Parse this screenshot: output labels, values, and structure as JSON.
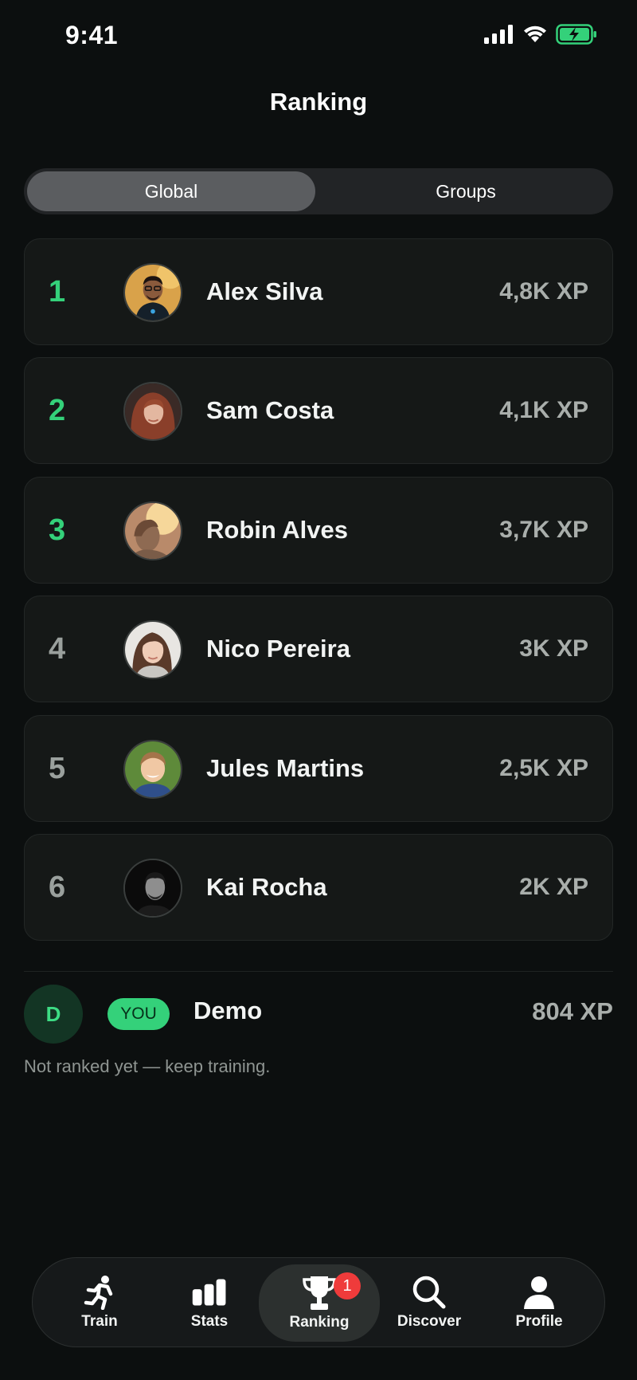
{
  "status_bar": {
    "time": "9:41"
  },
  "header": {
    "title": "Ranking"
  },
  "segments": {
    "global_label": "Global",
    "groups_label": "Groups",
    "selected": "Global"
  },
  "leaderboard": [
    {
      "rank": "1",
      "name": "Alex Silva",
      "xp": "4,8K XP",
      "highlight": true
    },
    {
      "rank": "2",
      "name": "Sam Costa",
      "xp": "4,1K XP",
      "highlight": true
    },
    {
      "rank": "3",
      "name": "Robin Alves",
      "xp": "3,7K XP",
      "highlight": true
    },
    {
      "rank": "4",
      "name": "Nico Pereira",
      "xp": "3K XP",
      "highlight": false
    },
    {
      "rank": "5",
      "name": "Jules Martins",
      "xp": "2,5K XP",
      "highlight": false
    },
    {
      "rank": "6",
      "name": "Kai Rocha",
      "xp": "2K XP",
      "highlight": false
    }
  ],
  "current_user": {
    "initial": "D",
    "badge": "YOU",
    "name": "Demo",
    "xp": "804 XP",
    "note": "Not ranked yet — keep training."
  },
  "tabbar": {
    "items": [
      {
        "label": "Train",
        "icon": "runner-icon"
      },
      {
        "label": "Stats",
        "icon": "bar-chart-icon"
      },
      {
        "label": "Ranking",
        "icon": "trophy-icon",
        "active": true,
        "badge": "1"
      },
      {
        "label": "Discover",
        "icon": "search-icon"
      },
      {
        "label": "Profile",
        "icon": "person-icon"
      }
    ]
  },
  "colors": {
    "accent": "#34d17a",
    "background": "#0c0f0f",
    "card": "#151817",
    "badge_red": "#ef3b3b"
  }
}
